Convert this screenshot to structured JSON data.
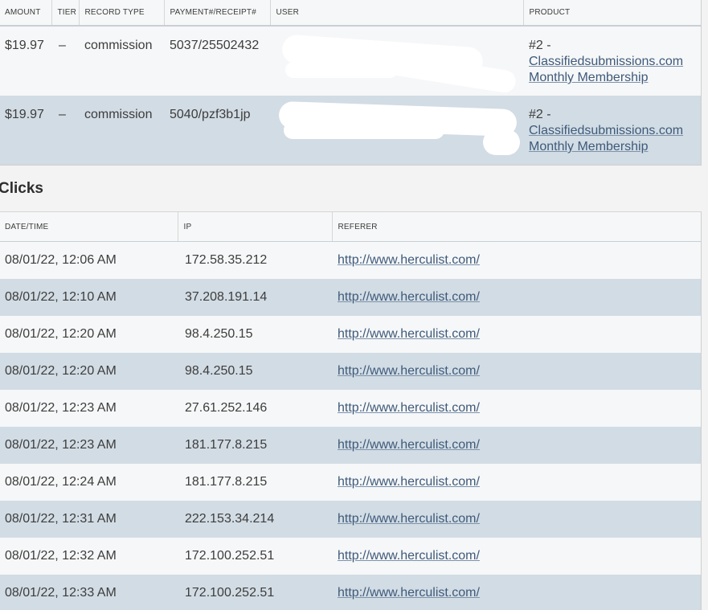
{
  "commissions": {
    "headers": {
      "amount": "AMOUNT",
      "tier": "TIER",
      "record_type": "RECORD TYPE",
      "payment_receipt": "PAYMENT#/RECEIPT#",
      "user": "USER",
      "product": "PRODUCT"
    },
    "rows": [
      {
        "amount": "$19.97",
        "tier": "–",
        "record_type": "commission",
        "payment_receipt": "5037/25502432",
        "user": "",
        "product_prefix": "#2 -",
        "product_name": "Classifiedsubmissions.com",
        "product_plan": "Monthly Membership"
      },
      {
        "amount": "$19.97",
        "tier": "–",
        "record_type": "commission",
        "payment_receipt": "5040/pzf3b1jp",
        "user": "",
        "product_prefix": "#2 -",
        "product_name": "Classifiedsubmissions.com",
        "product_plan": "Monthly Membership"
      }
    ]
  },
  "clicks": {
    "title": "Clicks",
    "headers": {
      "datetime": "DATE/TIME",
      "ip": "IP",
      "referer": "REFERER"
    },
    "rows": [
      {
        "datetime": "08/01/22, 12:06 AM",
        "ip": "172.58.35.212",
        "referer": "http://www.herculist.com/"
      },
      {
        "datetime": "08/01/22, 12:10 AM",
        "ip": "37.208.191.14",
        "referer": "http://www.herculist.com/"
      },
      {
        "datetime": "08/01/22, 12:20 AM",
        "ip": "98.4.250.15",
        "referer": "http://www.herculist.com/"
      },
      {
        "datetime": "08/01/22, 12:20 AM",
        "ip": "98.4.250.15",
        "referer": "http://www.herculist.com/"
      },
      {
        "datetime": "08/01/22, 12:23 AM",
        "ip": "27.61.252.146",
        "referer": "http://www.herculist.com/"
      },
      {
        "datetime": "08/01/22, 12:23 AM",
        "ip": "181.177.8.215",
        "referer": "http://www.herculist.com/"
      },
      {
        "datetime": "08/01/22, 12:24 AM",
        "ip": "181.177.8.215",
        "referer": "http://www.herculist.com/"
      },
      {
        "datetime": "08/01/22, 12:31 AM",
        "ip": "222.153.34.214",
        "referer": "http://www.herculist.com/"
      },
      {
        "datetime": "08/01/22, 12:32 AM",
        "ip": "172.100.252.51",
        "referer": "http://www.herculist.com/"
      },
      {
        "datetime": "08/01/22, 12:33 AM",
        "ip": "172.100.252.51",
        "referer": "http://www.herculist.com/"
      }
    ]
  },
  "colors": {
    "row_light": "#f6f7f8",
    "row_dark": "#d2dce4",
    "link": "#3e5a7a",
    "text": "#3d3d3d"
  }
}
